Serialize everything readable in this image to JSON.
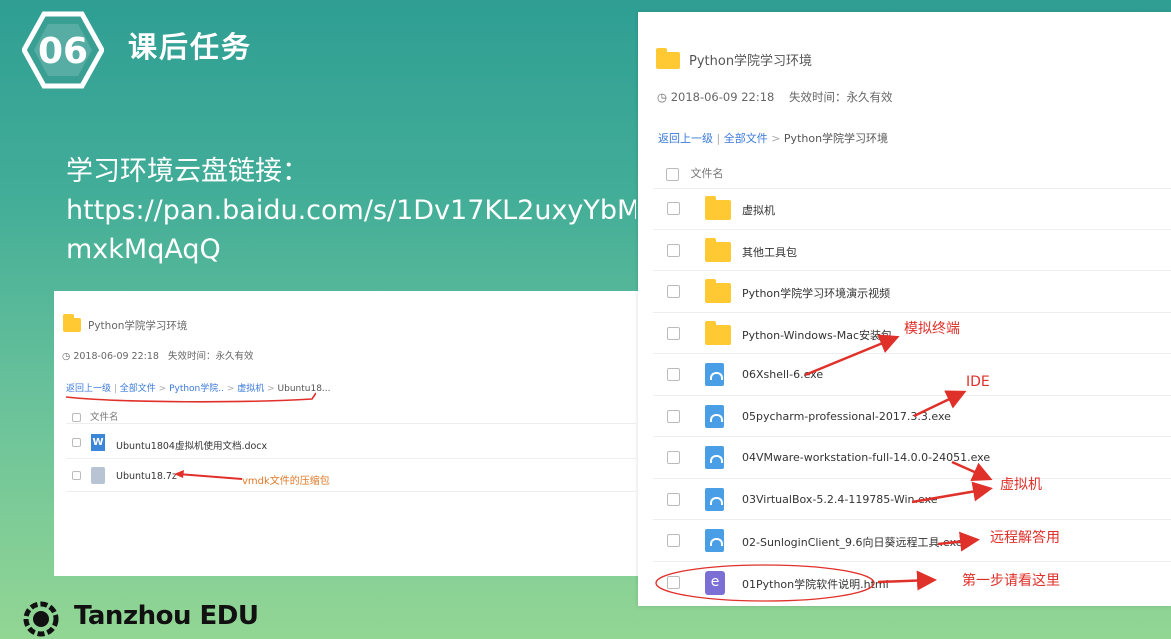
{
  "badge": {
    "number": "06"
  },
  "slide": {
    "title": "课后任务",
    "link_label": "学习环境云盘链接：",
    "link_line1": "https://pan.baidu.com/s/1Dv17KL2uxyYbM",
    "link_line2": "mxkMqAqQ"
  },
  "left_panel": {
    "title": "Python学院学习环境",
    "date": "2018-06-09 22:18",
    "validity": "失效时间：永久有效",
    "breadcrumb": {
      "back": "返回上一级",
      "all": "全部文件",
      "p1": "Python学院..",
      "p2": "虚拟机",
      "current": "Ubuntu18..."
    },
    "column_header": "文件名",
    "files": [
      {
        "name": "Ubuntu1804虚拟机使用文档.docx",
        "icon": "word-doc-icon"
      },
      {
        "name": "Ubuntu18.7z",
        "icon": "archive-icon"
      }
    ],
    "annotation": "vmdk文件的压缩包"
  },
  "right_panel": {
    "title": "Python学院学习环境",
    "date": "2018-06-09 22:18",
    "validity": "失效时间：永久有效",
    "breadcrumb": {
      "back": "返回上一级",
      "all": "全部文件",
      "current": "Python学院学习环境"
    },
    "column_header": "文件名",
    "files": [
      {
        "name": "虚拟机",
        "icon": "folder-icon"
      },
      {
        "name": "其他工具包",
        "icon": "folder-icon"
      },
      {
        "name": "Python学院学习环境演示视频",
        "icon": "folder-icon"
      },
      {
        "name": "Python-Windows-Mac安装包",
        "icon": "folder-icon"
      },
      {
        "name": "06Xshell-6.exe",
        "icon": "exe-file-icon"
      },
      {
        "name": "05pycharm-professional-2017.3.3.exe",
        "icon": "exe-file-icon"
      },
      {
        "name": "04VMware-workstation-full-14.0.0-24051.exe",
        "icon": "exe-file-icon"
      },
      {
        "name": "03VirtualBox-5.2.4-119785-Win.exe",
        "icon": "exe-file-icon"
      },
      {
        "name": "02-SunloginClient_9.6向日葵远程工具.exe",
        "icon": "exe-file-icon"
      },
      {
        "name": "01Python学院软件说明.html",
        "icon": "html-file-icon"
      }
    ]
  },
  "annotations": {
    "terminal": "模拟终端",
    "ide": "IDE",
    "vm": "虚拟机",
    "remote": "远程解答用",
    "first": "第一步请看这里"
  },
  "logo": {
    "text": "Tanzhou EDU"
  },
  "colors": {
    "accent": "#e0302a",
    "link": "#3b7ad9",
    "folder": "#ffc933",
    "bg_top": "#2f9e93",
    "bg_bottom": "#93d694"
  }
}
